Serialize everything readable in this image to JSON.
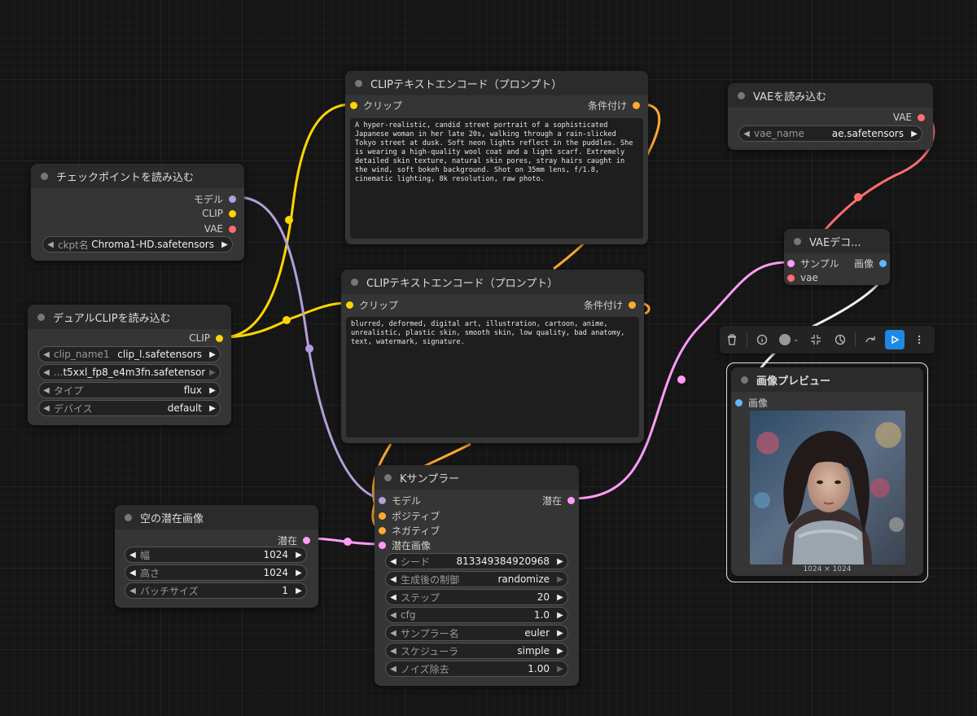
{
  "nodes": {
    "clip_text_encode_positive": {
      "title": "CLIPテキストエンコード（プロンプト）",
      "input_clip": "クリップ",
      "output_conditioning": "条件付け",
      "text": "A hyper-realistic, candid street portrait of a sophisticated Japanese woman in her late 20s, walking through a rain-slicked Tokyo street at dusk. Soft neon lights reflect in the puddles. She is wearing a high-quality wool coat and a light scarf. Extremely detailed skin texture, natural skin pores, stray hairs caught in the wind, soft bokeh background. Shot on 35mm lens, f/1.8, cinematic lighting, 8k resolution, raw photo."
    },
    "clip_text_encode_negative": {
      "title": "CLIPテキストエンコード（プロンプト）",
      "input_clip": "クリップ",
      "output_conditioning": "条件付け",
      "text": "blurred, deformed, digital art, illustration, cartoon, anime, unrealistic, plastic skin, smooth skin, low quality, bad anatomy, text, watermark, signature."
    },
    "checkpoint_loader": {
      "title": "チェックポイントを読み込む",
      "out_model": "モデル",
      "out_clip": "CLIP",
      "out_vae": "VAE",
      "widget_label": "ckpt名",
      "widget_value": "Chroma1-HD.safetensors"
    },
    "dual_clip_loader": {
      "title": "デュアルCLIPを読み込む",
      "out_clip": "CLIP",
      "widgets": [
        {
          "label": "clip_name1",
          "value": "clip_l.safetensors"
        },
        {
          "label": "...",
          "value": "t5xxl_fp8_e4m3fn.safetensors"
        },
        {
          "label": "タイプ",
          "value": "flux"
        },
        {
          "label": "デバイス",
          "value": "default"
        }
      ]
    },
    "vae_loader": {
      "title": "VAEを読み込む",
      "out_vae": "VAE",
      "widget_label": "vae_name",
      "widget_value": "ae.safetensors"
    },
    "vae_decode": {
      "title": "VAEデコ...",
      "in_samples": "サンプル",
      "in_vae": "vae",
      "out_image": "画像"
    },
    "ksampler": {
      "title": "Kサンプラー",
      "in_model": "モデル",
      "in_positive": "ポジティブ",
      "in_negative": "ネガティブ",
      "in_latent": "潜在画像",
      "out_latent": "潜在",
      "widgets": [
        {
          "label": "シード",
          "value": "813349384920968"
        },
        {
          "label": "生成後の制御",
          "value": "randomize"
        },
        {
          "label": "ステップ",
          "value": "20"
        },
        {
          "label": "cfg",
          "value": "1.0"
        },
        {
          "label": "サンプラー名",
          "value": "euler"
        },
        {
          "label": "スケジューラ",
          "value": "simple"
        },
        {
          "label": "ノイズ除去",
          "value": "1.00"
        }
      ]
    },
    "empty_latent": {
      "title": "空の潜在画像",
      "out_latent": "潜在",
      "widgets": [
        {
          "label": "幅",
          "value": "1024"
        },
        {
          "label": "高さ",
          "value": "1024"
        },
        {
          "label": "バッチサイズ",
          "value": "1"
        }
      ]
    },
    "preview_image": {
      "title": "画像プレビュー",
      "in_images": "画像",
      "image_size": "1024 × 1024"
    }
  },
  "toolbar": {
    "icons": [
      "trash-icon",
      "info-icon",
      "color-picker-icon",
      "chevron-down-icon",
      "fit-view-icon",
      "bypass-icon",
      "convert-icon",
      "run-icon",
      "more-icon"
    ]
  },
  "colors": {
    "background": "#151515",
    "node_body": "#353535",
    "node_title": "#2b2b2b",
    "link_clip": "#ffd500",
    "link_model": "#b39ddb",
    "link_vae": "#ff6e6e",
    "link_conditioning": "#ffa931",
    "link_latent": "#ff9cf9",
    "link_image": "#64b5f6",
    "run_button": "#1e88e5"
  }
}
